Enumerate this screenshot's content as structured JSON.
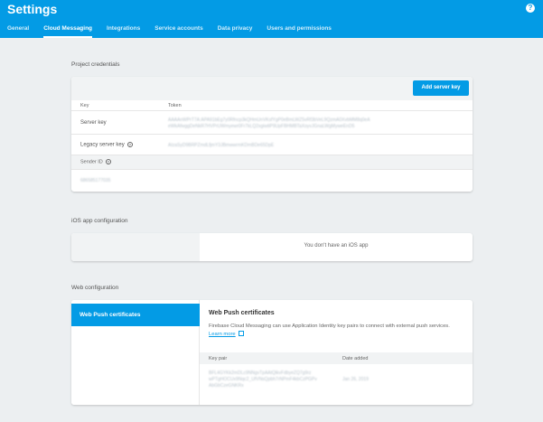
{
  "header": {
    "title": "Settings",
    "help_icon": "question-circle-icon",
    "tabs": [
      {
        "label": "General",
        "active": false
      },
      {
        "label": "Cloud Messaging",
        "active": true
      },
      {
        "label": "Integrations",
        "active": false
      },
      {
        "label": "Service accounts",
        "active": false
      },
      {
        "label": "Data privacy",
        "active": false
      },
      {
        "label": "Users and permissions",
        "active": false
      }
    ]
  },
  "credentials": {
    "section_title": "Project credentials",
    "add_button": "Add server key",
    "col_key": "Key",
    "col_token": "Token",
    "server_key_label": "Server key",
    "server_key_token_line1": "AAAAnWPrT7A:APA91bEg7y0Rfncp3kQHmUnVKsfYgP0eBmLWZ5vRf3bVeL9QzmA0XvbMM8q0eA",
    "server_key_token_line2": "eWkAfwggDeNkR7HVPrUWmyewr0Fr7kLQ2xgiwtiP9UpFBHMBTaXoyvJGnaLWgMyweEnD5",
    "legacy_key_label": "Legacy server key",
    "legacy_key_token": "AIzaSyD9BRPZmdLfjmY3JBmwwrmKDmBDe65DpE",
    "sender_id_label": "Sender ID",
    "sender_id_value": "686585177035"
  },
  "ios": {
    "section_title": "iOS app configuration",
    "message": "You don't have an iOS app"
  },
  "web": {
    "section_title": "Web configuration",
    "nav_item": "Web Push certificates",
    "heading": "Web Push certificates",
    "description": "Firebase Cloud Messaging can use Application Identity key pairs to connect with external push services.",
    "learn_more": "Learn more",
    "col_key_pair": "Key pair",
    "col_date_added": "Date added",
    "key_pair_line1": "BFL4GYKk2mDLc9NNgvTpAAtQlkvFdbyeZQ7g9rz",
    "key_pair_line2": "wPTgHOCUx9Nqc2_UfVNsQpbh7rNPmF4kbCzPGPv",
    "key_pair_line3": "AbGbCzeGNKRx",
    "date_added": "Jan 26, 2019"
  }
}
